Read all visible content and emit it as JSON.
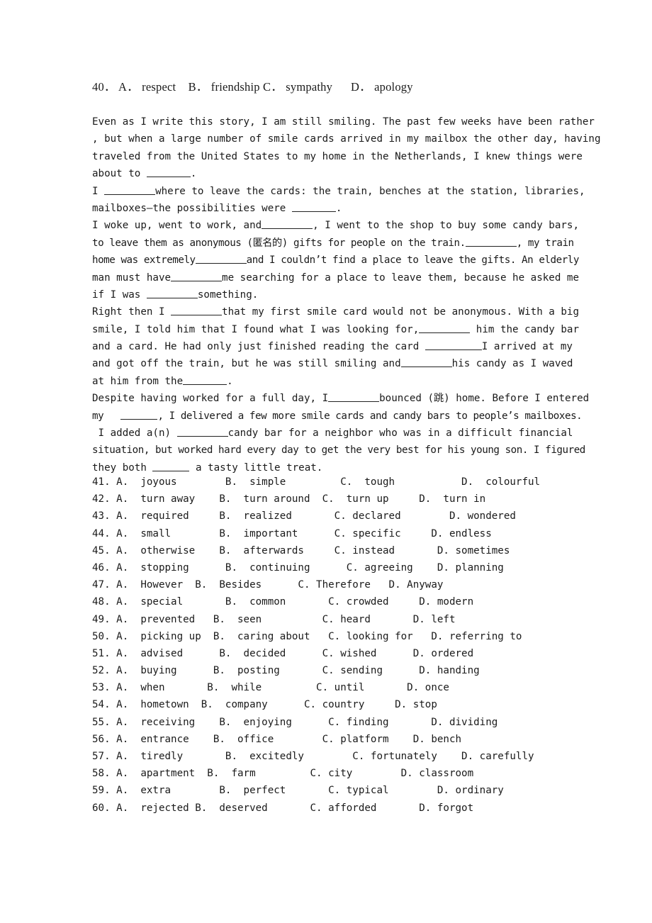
{
  "document": {
    "type": "english-cloze-test-worksheet",
    "page_background": "#ffffff",
    "text_color": "#1a1a1a"
  },
  "question_40": {
    "number": "40.",
    "options": "A． respect    B． friendship C． sympathy      D． apology",
    "full_line": "40． A． respect    B． friendship C． sympathy      D． apology"
  },
  "passage": {
    "lines": [
      "Even as I write this story, I am still smiling. The past few weeks have been rather",
      ", but when a large number of smile cards arrived in my mailbox the other day, having",
      "traveled from the United States to my home in the Netherlands, I knew things were",
      "about to ",
      "I ",
      "where to leave the cards: the train, benches at the station, libraries,",
      "mailboxes—the possibilities were ",
      "I woke up, went to work, and",
      ", I went to the shop to buy some candy bars,",
      "to leave them as anonymous (匿名的) gifts for people on the train.",
      ", my train",
      "home was extremely",
      "and I couldn’t find a place to leave the gifts. An elderly",
      "man must have",
      "me searching for a place to leave them, because he asked me",
      "if I was ",
      "something.",
      "Right then I ",
      "that my first smile card would not be anonymous. With a big",
      "smile, I told him that I found what I was looking for,",
      " him the candy bar",
      "and a card. He had only just finished reading the card ",
      "I arrived at my",
      "and got off the train, but he was still smiling and",
      "his candy as I waved",
      "at him from the",
      ".",
      "Despite having worked for a full day, I",
      "bounced (跳) home. Before I entered",
      "my",
      ", I delivered a few more smile cards and candy bars to people’s mailboxes.",
      "I added a(n) ",
      "candy bar for a neighbor who was in a difficult financial",
      "situation, but worked hard every day to get the very best for his young son. I figured",
      "they both ",
      " a tasty little treat."
    ],
    "annotations": {
      "chinese_gloss_1": "匿名的",
      "chinese_gloss_2": "跳"
    }
  },
  "questions": [
    {
      "number": "41.",
      "options": [
        {
          "letter": "A.",
          "text": "joyous"
        },
        {
          "letter": "B.",
          "text": "simple"
        },
        {
          "letter": "C.",
          "text": "tough"
        },
        {
          "letter": "D.",
          "text": "colourful"
        }
      ],
      "line": "41. A.  joyous        B.  simple         C.  tough           D.  colourful"
    },
    {
      "number": "42.",
      "options": [
        {
          "letter": "A.",
          "text": "turn away"
        },
        {
          "letter": "B.",
          "text": "turn around"
        },
        {
          "letter": "C.",
          "text": "turn up"
        },
        {
          "letter": "D.",
          "text": "turn in"
        }
      ],
      "line": "42. A.  turn away    B.  turn around  C.  turn up     D.  turn in"
    },
    {
      "number": "43.",
      "options": [
        {
          "letter": "A.",
          "text": "required"
        },
        {
          "letter": "B.",
          "text": "realized"
        },
        {
          "letter": "C.",
          "text": "declared"
        },
        {
          "letter": "D.",
          "text": "wondered"
        }
      ],
      "line": "43. A.  required     B.  realized       C. declared        D. wondered"
    },
    {
      "number": "44.",
      "options": [
        {
          "letter": "A.",
          "text": "small"
        },
        {
          "letter": "B.",
          "text": "important"
        },
        {
          "letter": "C.",
          "text": "specific"
        },
        {
          "letter": "D.",
          "text": "endless"
        }
      ],
      "line": "44. A.  small        B.  important      C. specific     D. endless"
    },
    {
      "number": "45.",
      "options": [
        {
          "letter": "A.",
          "text": "otherwise"
        },
        {
          "letter": "B.",
          "text": "afterwards"
        },
        {
          "letter": "C.",
          "text": "instead"
        },
        {
          "letter": "D.",
          "text": "sometimes"
        }
      ],
      "line": "45. A.  otherwise    B.  afterwards     C. instead       D. sometimes"
    },
    {
      "number": "46.",
      "options": [
        {
          "letter": "A.",
          "text": "stopping"
        },
        {
          "letter": "B.",
          "text": "continuing"
        },
        {
          "letter": "C.",
          "text": "agreeing"
        },
        {
          "letter": "D.",
          "text": "planning"
        }
      ],
      "line": "46. A.  stopping      B.  continuing      C. agreeing    D. planning"
    },
    {
      "number": "47.",
      "options": [
        {
          "letter": "A.",
          "text": "However"
        },
        {
          "letter": "B.",
          "text": "Besides"
        },
        {
          "letter": "C.",
          "text": "Therefore"
        },
        {
          "letter": "D.",
          "text": "Anyway"
        }
      ],
      "line": "47. A.  However  B.  Besides      C. Therefore   D. Anyway"
    },
    {
      "number": "48.",
      "options": [
        {
          "letter": "A.",
          "text": "special"
        },
        {
          "letter": "B.",
          "text": "common"
        },
        {
          "letter": "C.",
          "text": "crowded"
        },
        {
          "letter": "D.",
          "text": "modern"
        }
      ],
      "line": "48. A.  special       B.  common       C. crowded     D. modern"
    },
    {
      "number": "49.",
      "options": [
        {
          "letter": "A.",
          "text": "prevented"
        },
        {
          "letter": "B.",
          "text": "seen"
        },
        {
          "letter": "C.",
          "text": "heard"
        },
        {
          "letter": "D.",
          "text": "left"
        }
      ],
      "line": "49. A.  prevented   B.  seen          C. heard       D. left"
    },
    {
      "number": "50.",
      "options": [
        {
          "letter": "A.",
          "text": "picking up"
        },
        {
          "letter": "B.",
          "text": "caring about"
        },
        {
          "letter": "C.",
          "text": "looking for"
        },
        {
          "letter": "D.",
          "text": "referring to"
        }
      ],
      "line": "50. A.  picking up  B.  caring about   C. looking for   D. referring to"
    },
    {
      "number": "51.",
      "options": [
        {
          "letter": "A.",
          "text": "advised"
        },
        {
          "letter": "B.",
          "text": "decided"
        },
        {
          "letter": "C.",
          "text": "wished"
        },
        {
          "letter": "D.",
          "text": "ordered"
        }
      ],
      "line": "51. A.  advised      B.  decided      C. wished      D. ordered"
    },
    {
      "number": "52.",
      "options": [
        {
          "letter": "A.",
          "text": "buying"
        },
        {
          "letter": "B.",
          "text": "posting"
        },
        {
          "letter": "C.",
          "text": "sending"
        },
        {
          "letter": "D.",
          "text": "handing"
        }
      ],
      "line": "52. A.  buying      B.  posting       C. sending      D. handing"
    },
    {
      "number": "53.",
      "options": [
        {
          "letter": "A.",
          "text": "when"
        },
        {
          "letter": "B.",
          "text": "while"
        },
        {
          "letter": "C.",
          "text": "until"
        },
        {
          "letter": "D.",
          "text": "once"
        }
      ],
      "line": "53. A.  when       B.  while         C. until       D. once"
    },
    {
      "number": "54.",
      "options": [
        {
          "letter": "A.",
          "text": "hometown"
        },
        {
          "letter": "B.",
          "text": "company"
        },
        {
          "letter": "C.",
          "text": "country"
        },
        {
          "letter": "D.",
          "text": "stop"
        }
      ],
      "line": "54. A.  hometown  B.  company      C. country     D. stop"
    },
    {
      "number": "55.",
      "options": [
        {
          "letter": "A.",
          "text": "receiving"
        },
        {
          "letter": "B.",
          "text": "enjoying"
        },
        {
          "letter": "C.",
          "text": "finding"
        },
        {
          "letter": "D.",
          "text": "dividing"
        }
      ],
      "line": "55. A.  receiving    B.  enjoying      C. finding       D. dividing"
    },
    {
      "number": "56.",
      "options": [
        {
          "letter": "A.",
          "text": "entrance"
        },
        {
          "letter": "B.",
          "text": "office"
        },
        {
          "letter": "C.",
          "text": "platform"
        },
        {
          "letter": "D.",
          "text": "bench"
        }
      ],
      "line": "56. A.  entrance    B.  office        C. platform    D. bench"
    },
    {
      "number": "57.",
      "options": [
        {
          "letter": "A.",
          "text": "tiredly"
        },
        {
          "letter": "B.",
          "text": "excitedly"
        },
        {
          "letter": "C.",
          "text": "fortunately"
        },
        {
          "letter": "D.",
          "text": "carefully"
        }
      ],
      "line": "57. A.  tiredly       B.  excitedly        C. fortunately    D. carefully"
    },
    {
      "number": "58.",
      "options": [
        {
          "letter": "A.",
          "text": "apartment"
        },
        {
          "letter": "B.",
          "text": "farm"
        },
        {
          "letter": "C.",
          "text": "city"
        },
        {
          "letter": "D.",
          "text": "classroom"
        }
      ],
      "line": "58. A.  apartment  B.  farm         C. city        D. classroom"
    },
    {
      "number": "59.",
      "options": [
        {
          "letter": "A.",
          "text": "extra"
        },
        {
          "letter": "B.",
          "text": "perfect"
        },
        {
          "letter": "C.",
          "text": "typical"
        },
        {
          "letter": "D.",
          "text": "ordinary"
        }
      ],
      "line": "59. A.  extra        B.  perfect       C. typical        D. ordinary"
    },
    {
      "number": "60.",
      "options": [
        {
          "letter": "A.",
          "text": "rejected"
        },
        {
          "letter": "B.",
          "text": "deserved"
        },
        {
          "letter": "C.",
          "text": "afforded"
        },
        {
          "letter": "D.",
          "text": "forgot"
        }
      ],
      "line": "60. A.  rejected B.  deserved       C. afforded       D. forgot"
    }
  ]
}
